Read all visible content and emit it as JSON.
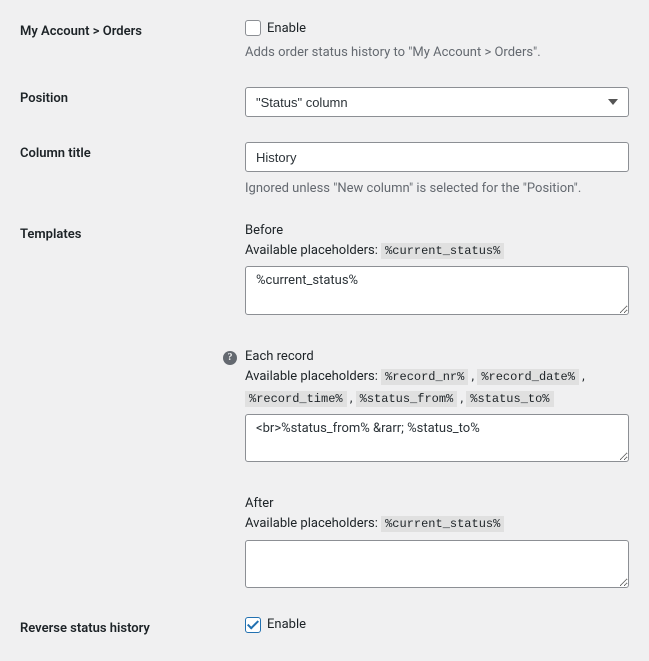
{
  "myAccountOrders": {
    "label": "My Account > Orders",
    "enableLabel": "Enable",
    "description": "Adds order status history to \"My Account > Orders\"."
  },
  "position": {
    "label": "Position",
    "value": "\"Status\" column"
  },
  "columnTitle": {
    "label": "Column title",
    "value": "History",
    "description": "Ignored unless \"New column\" is selected for the \"Position\"."
  },
  "templates": {
    "label": "Templates",
    "placeholdersPrefix": "Available placeholders: ",
    "before": {
      "title": "Before",
      "placeholders": [
        "%current_status%"
      ],
      "value": "%current_status%"
    },
    "eachRecord": {
      "title": "Each record",
      "placeholders": [
        "%record_nr%",
        "%record_date%",
        "%record_time%",
        "%status_from%",
        "%status_to%"
      ],
      "value": "<br>%status_from% &rarr; %status_to%"
    },
    "after": {
      "title": "After",
      "placeholders": [
        "%current_status%"
      ],
      "value": ""
    }
  },
  "reverseHistory": {
    "label": "Reverse status history",
    "enableLabel": "Enable"
  }
}
